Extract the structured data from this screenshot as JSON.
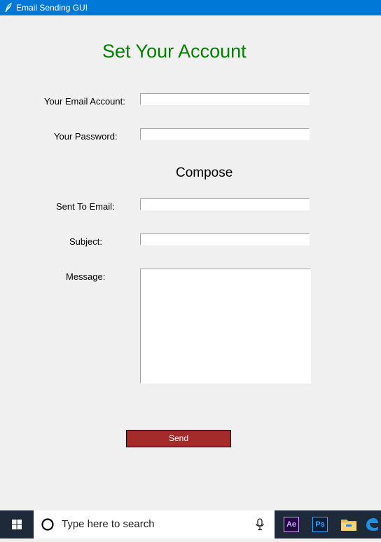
{
  "window": {
    "title": "Email Sending GUI"
  },
  "form": {
    "heading": "Set Your Account",
    "email_label": "Your Email Account:",
    "email_value": "",
    "password_label": "Your Password:",
    "password_value": "",
    "compose_heading": "Compose",
    "to_label": "Sent To Email:",
    "to_value": "",
    "subject_label": "Subject:",
    "subject_value": "",
    "message_label": "Message:",
    "message_value": "",
    "send_label": "Send"
  },
  "colors": {
    "heading": "#008000",
    "send_button": "#a52a2a",
    "titlebar": "#0078d7"
  },
  "taskbar": {
    "search_placeholder": "Type here to search",
    "apps": [
      {
        "name": "after-effects-icon",
        "label": "Ae"
      },
      {
        "name": "photoshop-icon",
        "label": "Ps"
      },
      {
        "name": "file-explorer-icon"
      },
      {
        "name": "edge-icon"
      }
    ]
  }
}
